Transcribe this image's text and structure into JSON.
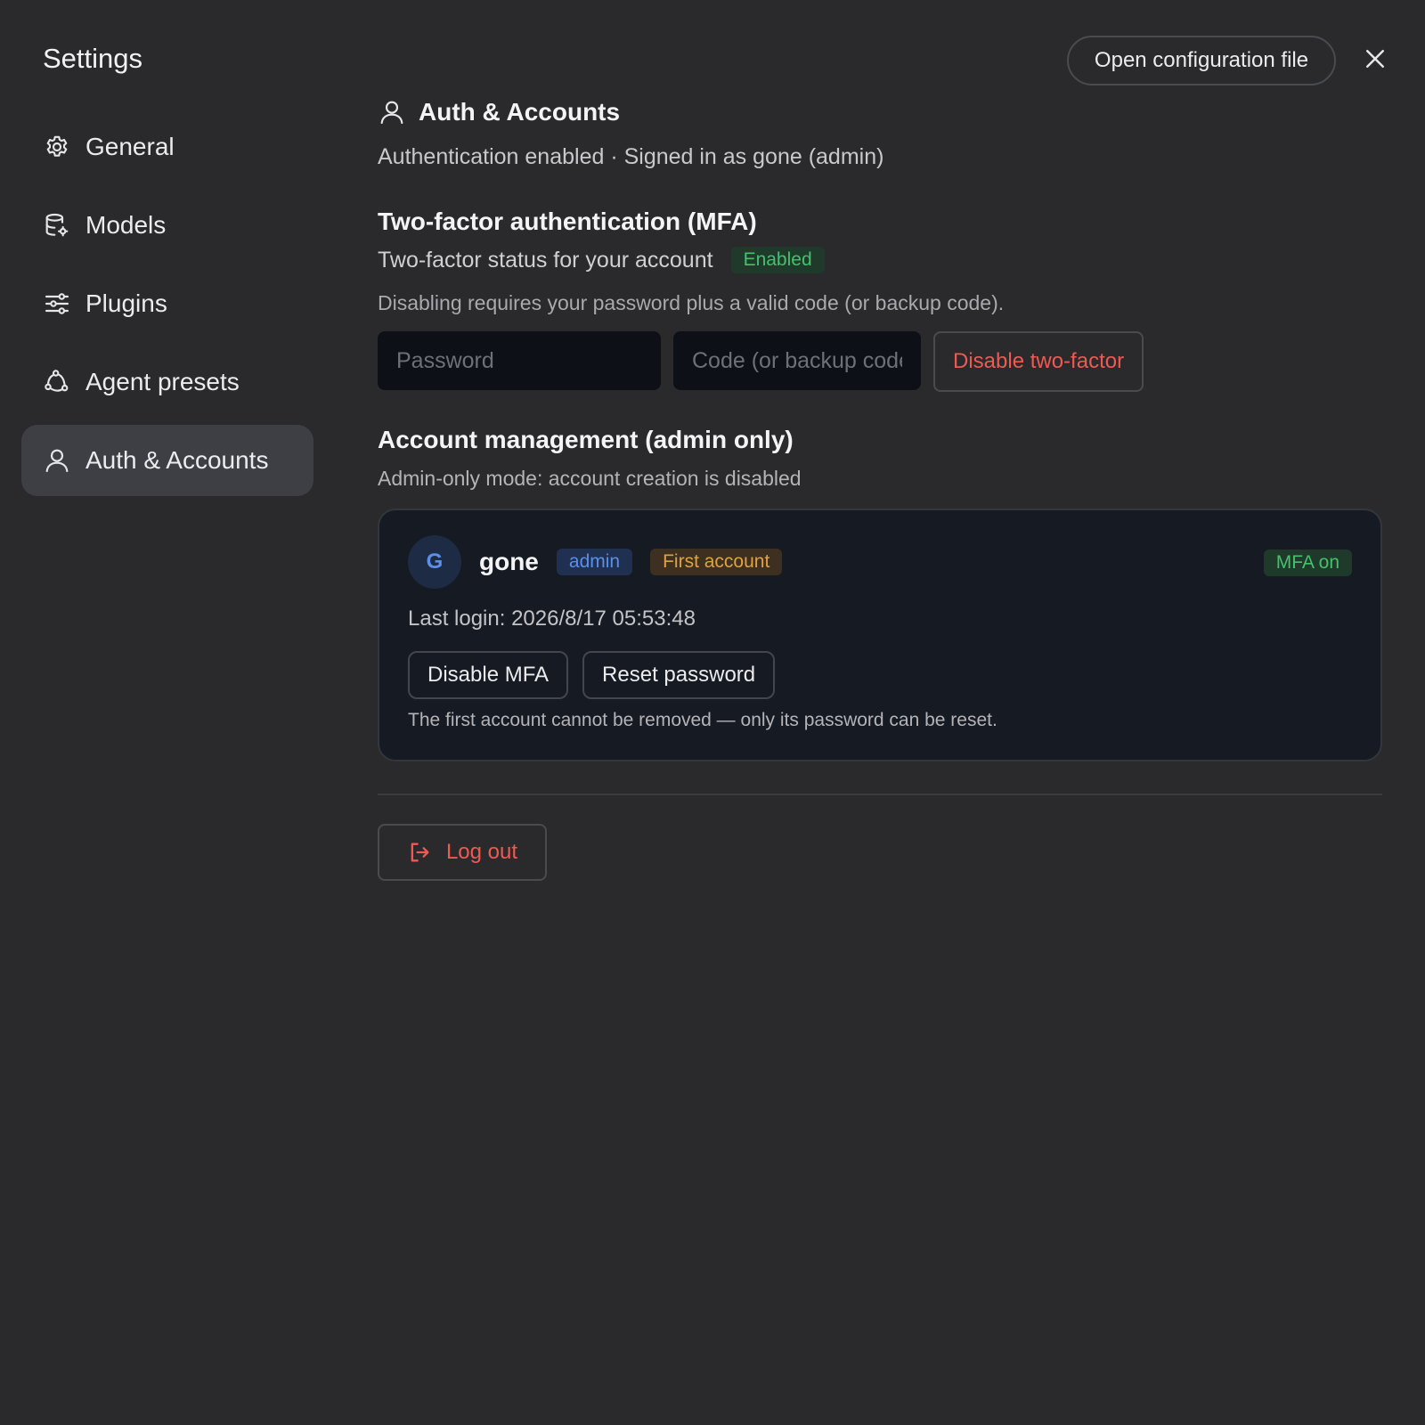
{
  "app": {
    "title": "Settings"
  },
  "header": {
    "open_config_label": "Open configuration file"
  },
  "sidebar": {
    "items": [
      {
        "label": "General",
        "icon": "gear-icon"
      },
      {
        "label": "Models",
        "icon": "database-gear-icon"
      },
      {
        "label": "Plugins",
        "icon": "sliders-icon"
      },
      {
        "label": "Agent presets",
        "icon": "nodes-icon"
      },
      {
        "label": "Auth & Accounts",
        "icon": "user-icon",
        "active": true
      }
    ]
  },
  "main": {
    "section_title": "Auth & Accounts",
    "status_line": "Authentication enabled · Signed in as gone (admin)",
    "mfa": {
      "title": "Two-factor authentication (MFA)",
      "status_text": "Two-factor status for your account",
      "status_badge": "Enabled",
      "help": "Disabling requires your password plus a valid code (or backup code).",
      "password_placeholder": "Password",
      "code_placeholder": "Code (or backup code)",
      "disable_label": "Disable two-factor"
    },
    "accounts": {
      "title": "Account management (admin only)",
      "subtitle": "Admin-only mode: account creation is disabled",
      "list": [
        {
          "initial": "G",
          "name": "gone",
          "role_badge": "admin",
          "first_badge": "First account",
          "mfa_badge": "MFA on",
          "last_login": "Last login: 2026/8/17 05:53:48",
          "disable_mfa_label": "Disable MFA",
          "reset_password_label": "Reset password",
          "note": "The first account cannot be removed — only its password can be reset."
        }
      ]
    },
    "logout_label": "Log out"
  },
  "colors": {
    "background": "#2a2a2d",
    "danger": "#ee5a52",
    "success": "#45c06b",
    "info": "#5b8fe8",
    "warning": "#e0a143"
  }
}
